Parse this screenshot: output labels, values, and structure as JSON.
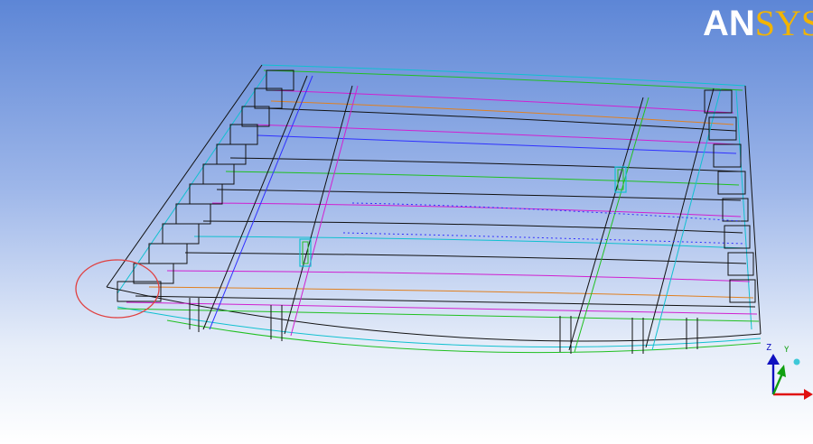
{
  "logo": {
    "part1": "AN",
    "part2": "SYS"
  },
  "triad": {
    "z": "Z",
    "y": "Y"
  },
  "colors": {
    "black": "#111111",
    "magenta": "#d020d0",
    "green": "#20c020",
    "cyan": "#10c0d0",
    "blue": "#3030ff",
    "orange": "#e08020",
    "red": "#e04040",
    "axis_x": "#e01010",
    "axis_y": "#10a010",
    "axis_z": "#1010c0"
  }
}
